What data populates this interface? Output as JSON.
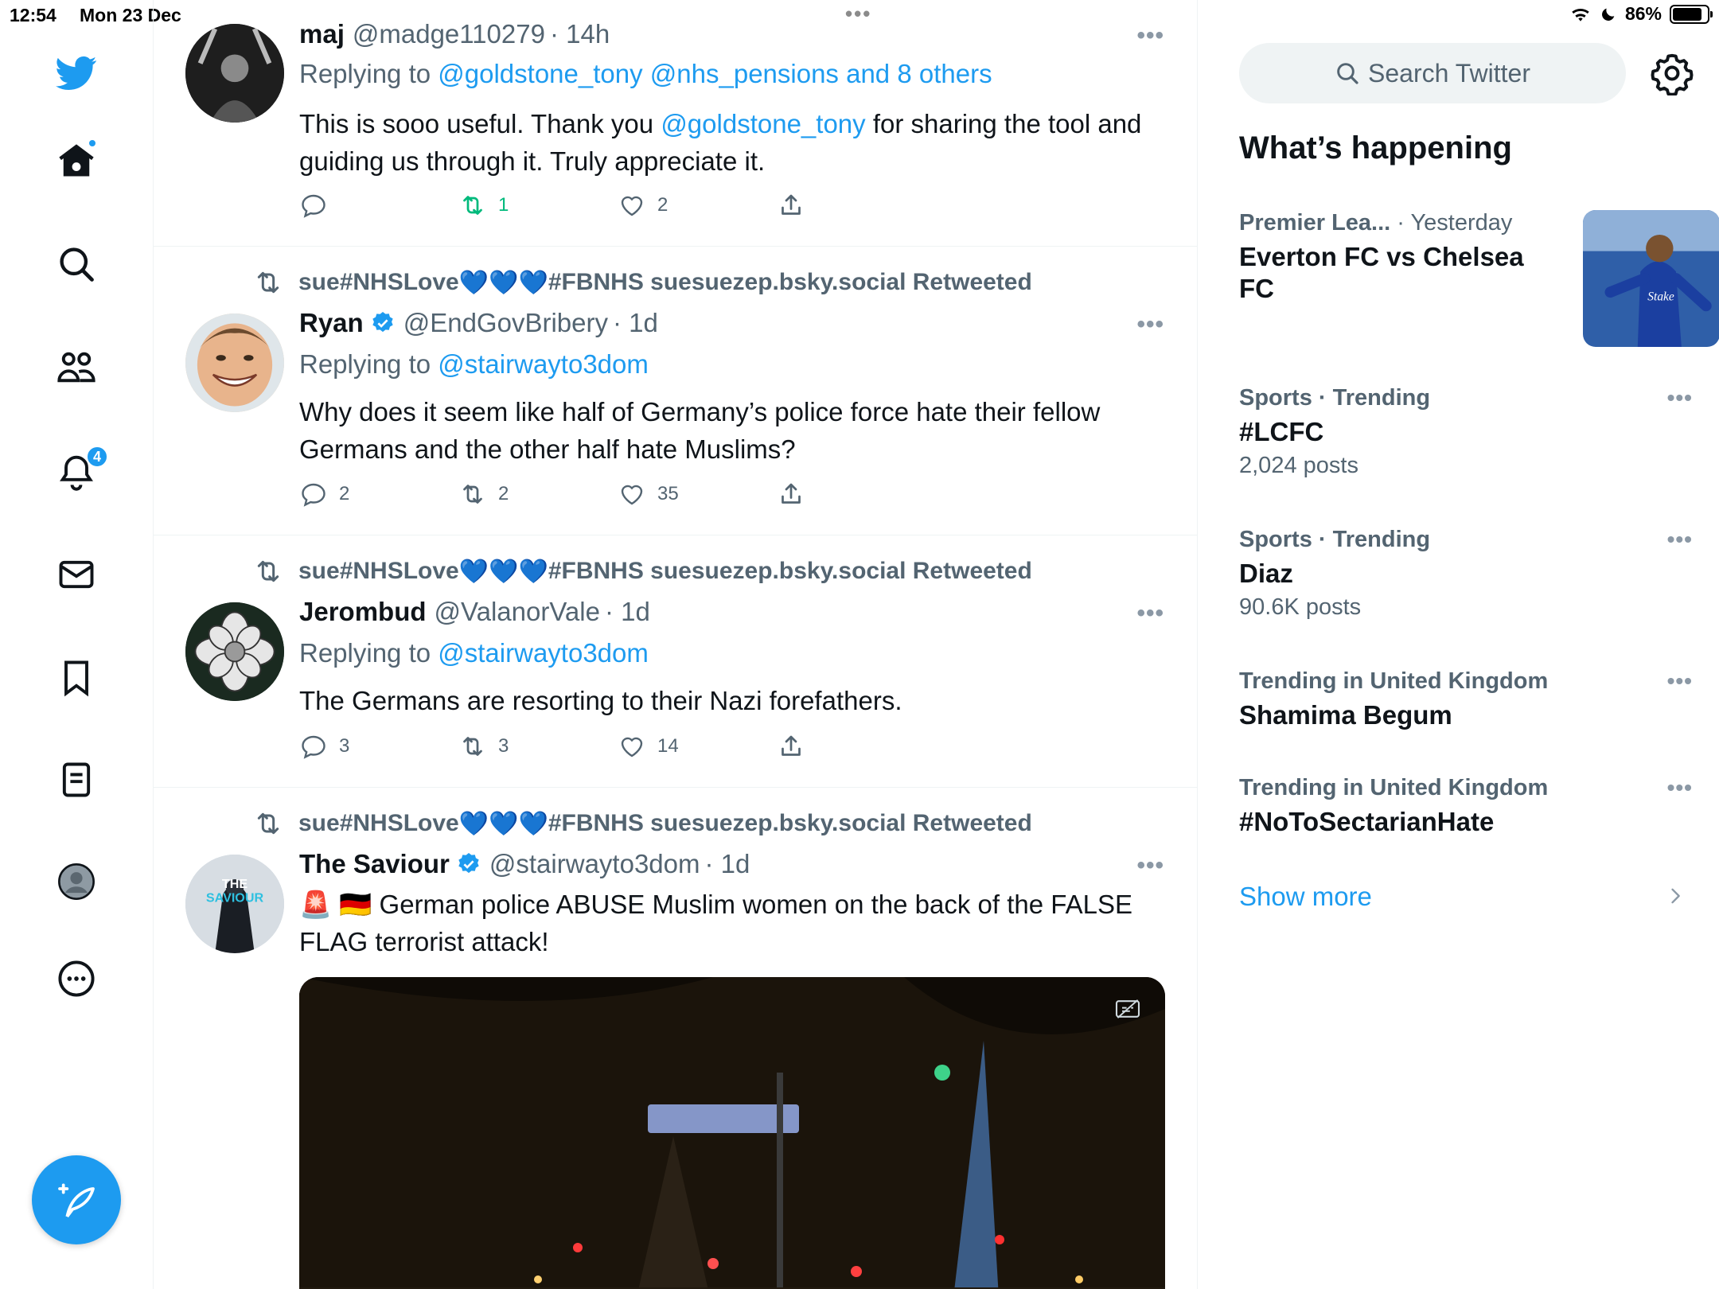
{
  "status": {
    "time": "12:54",
    "date": "Mon 23 Dec",
    "battery": "86%",
    "battery_level": 0.86
  },
  "nav": {
    "icons": [
      "twitter-logo-icon",
      "home-icon",
      "search-icon",
      "communities-icon",
      "notifications-icon",
      "messages-icon",
      "bookmarks-icon",
      "lists-icon",
      "profile-icon",
      "more-icon",
      "compose-icon"
    ],
    "notifications_count": "4"
  },
  "tweets": [
    {
      "name": "maj",
      "handle": "@madge110279",
      "time": "· 14h",
      "replying_prefix": "Replying to ",
      "replying_to": "@goldstone_tony @nhs_pensions and 8 others",
      "text_before": "This is sooo useful. Thank you ",
      "text_mention": "@goldstone_tony",
      "text_after": " for sharing the tool and guiding us through it. Truly appreciate it.",
      "replies": "",
      "retweets": "1",
      "likes": "2"
    },
    {
      "retweeted_by_prefix": "sue#NHSLove",
      "retweeted_by_hearts": "💙💙💙",
      "retweeted_by_suffix": "#FBNHS suesuezep.bsky.social Retweeted",
      "name": "Ryan",
      "handle": "@EndGovBribery",
      "time": "· 1d",
      "replying_prefix": "Replying to ",
      "replying_to": "@stairwayto3dom",
      "text": "Why does it seem like half of Germany’s police force hate their fellow Germans and the other half hate Muslims?",
      "replies": "2",
      "retweets": "2",
      "likes": "35"
    },
    {
      "retweeted_by_prefix": "sue#NHSLove",
      "retweeted_by_hearts": "💙💙💙",
      "retweeted_by_suffix": "#FBNHS suesuezep.bsky.social Retweeted",
      "name": "Jerombud",
      "handle": "@ValanorVale",
      "time": "· 1d",
      "replying_prefix": "Replying to ",
      "replying_to": "@stairwayto3dom",
      "text": "The Germans are resorting to their Nazi forefathers.",
      "replies": "3",
      "retweets": "3",
      "likes": "14"
    },
    {
      "retweeted_by_prefix": "sue#NHSLove",
      "retweeted_by_hearts": "💙💙💙",
      "retweeted_by_suffix": "#FBNHS suesuezep.bsky.social Retweeted",
      "name": "The Saviour",
      "handle": "@stairwayto3dom",
      "time": "· 1d",
      "emoji": "🚨 🇩🇪",
      "text": "German police ABUSE Muslim women on the back of the FALSE FLAG terrorist attack!",
      "avatar_text_1": "THE",
      "avatar_text_2": "SAVIOUR"
    }
  ],
  "sidebar": {
    "search_placeholder": "Search Twitter",
    "title": "What’s happening",
    "trends": [
      {
        "category": "Premier Lea...",
        "time": "· Yesterday",
        "name": "Everton FC vs Chelsea FC"
      },
      {
        "category": "Sports · Trending",
        "name": "#LCFC",
        "count": "2,024 posts"
      },
      {
        "category": "Sports · Trending",
        "name": "Diaz",
        "count": "90.6K posts"
      },
      {
        "category": "Trending in United Kingdom",
        "name": "Shamima Begum"
      },
      {
        "category": "Trending in United Kingdom",
        "name": "#NoToSectarianHate"
      }
    ],
    "show_more": "Show more"
  },
  "colors": {
    "accent": "#1d9bf0",
    "retweet_active": "#00ba7c",
    "secondary_text": "#536471"
  }
}
